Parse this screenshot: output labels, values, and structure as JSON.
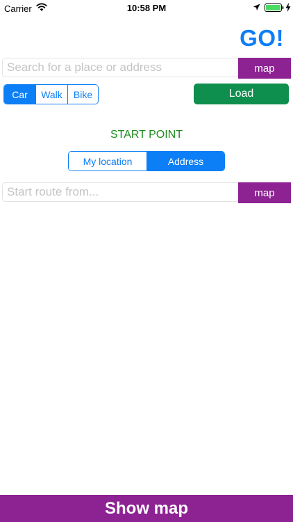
{
  "status_bar": {
    "carrier": "Carrier",
    "time": "10:58 PM",
    "icons": [
      "wifi-icon",
      "location-arrow-icon",
      "battery-icon",
      "charging-bolt-icon"
    ]
  },
  "header": {
    "title": "GO!",
    "title_color": "#0c7ef6"
  },
  "search": {
    "placeholder": "Search for a place or address",
    "value": "",
    "map_button_label": "map"
  },
  "transport_modes": {
    "items": [
      {
        "label": "Car",
        "selected": true
      },
      {
        "label": "Walk",
        "selected": false
      },
      {
        "label": "Bike",
        "selected": false
      }
    ]
  },
  "load_button": {
    "label": "Load",
    "color": "#0f8f4d"
  },
  "start_point": {
    "title": "START POINT",
    "title_color": "#1a8a1a",
    "options": [
      {
        "label": "My location",
        "selected": false
      },
      {
        "label": "Address",
        "selected": true
      }
    ],
    "route_placeholder": "Start route from...",
    "route_value": "",
    "map_button_label": "map"
  },
  "footer": {
    "show_map_label": "Show map"
  },
  "colors": {
    "accent_blue": "#0c7ef6",
    "map_purple": "#8d2293",
    "load_green": "#0f8f4d"
  }
}
